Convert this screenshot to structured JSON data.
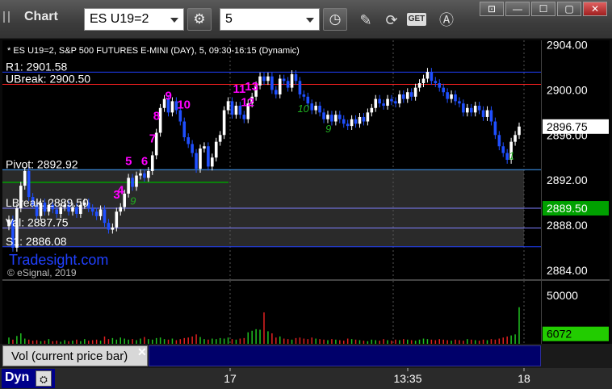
{
  "toolbar": {
    "title": "Chart",
    "symbol": "ES U19=2",
    "interval": "5",
    "get_label": "GET"
  },
  "colors": {
    "up_candle": "#ffffff",
    "down_candle": "#1f4fff",
    "r1_line": "#2040ff",
    "ubreak_line": "#ff2020",
    "pivot_line": "#40a0ff",
    "lbreak_line": "#7f7fff",
    "s1_line": "#2040ff",
    "green_line": "#00a000",
    "magenta_label": "#ff00ff",
    "green_label": "#20b020",
    "last_price_bg": "#ffffff",
    "lbreak_price_bg": "#00a000",
    "vol_label_bg": "#22cc00"
  },
  "chart_data": {
    "type": "candlestick",
    "title": "* ES U19=2, S&P 500 FUTURES E-MINI (DAY), 5, 09:30-16:15 (Dynamic)",
    "watermark": "Tradesight.com",
    "copyright": "© eSignal, 2019",
    "y_ticks": [
      "2904.00",
      "2900.00",
      "2896.00",
      "2892.00",
      "2888.00",
      "2884.00"
    ],
    "y_range": [
      2883.2,
      2904.4
    ],
    "x_ticks": [
      "17",
      "13:35",
      "18"
    ],
    "levels": [
      {
        "name": "R1",
        "label": "R1: 2901.58",
        "value": 2901.58
      },
      {
        "name": "UBreak",
        "label": "UBreak: 2900.50",
        "value": 2900.5
      },
      {
        "name": "Pivot",
        "label": "Pivot: 2892.92",
        "value": 2892.92
      },
      {
        "name": "LBreak",
        "label": "LBreak: 2889.50",
        "value": 2889.5
      },
      {
        "name": "Val",
        "label": "Val: 2887.75",
        "value": 2887.75
      },
      {
        "name": "S1",
        "label": "S1: 2886.08",
        "value": 2886.08
      }
    ],
    "green_level": 2891.8,
    "last_price": "2896.75",
    "lbreak_tag": "2889.50",
    "closes": [
      2888.5,
      2886.0,
      2889.5,
      2891.5,
      2892.8,
      2890.5,
      2889.8,
      2888.8,
      2890.0,
      2889.2,
      2889.8,
      2889.4,
      2889.0,
      2889.6,
      2889.8,
      2889.2,
      2889.6,
      2889.0,
      2889.8,
      2890.0,
      2889.5,
      2889.2,
      2888.8,
      2889.4,
      2888.2,
      2887.6,
      2887.8,
      2889.2,
      2889.6,
      2890.8,
      2892.2,
      2891.4,
      2892.4,
      2892.6,
      2892.2,
      2892.8,
      2894.2,
      2896.2,
      2898.4,
      2899.2,
      2898.0,
      2899.0,
      2898.2,
      2897.2,
      2895.8,
      2895.2,
      2894.4,
      2893.0,
      2894.8,
      2895.0,
      2893.2,
      2894.0,
      2895.4,
      2896.0,
      2898.2,
      2899.0,
      2897.8,
      2898.6,
      2897.8,
      2897.4,
      2898.8,
      2899.4,
      2900.4,
      2901.2,
      2900.8,
      2901.2,
      2900.0,
      2899.6,
      2901.0,
      2900.8,
      2900.2,
      2901.4,
      2900.8,
      2899.6,
      2899.4,
      2898.8,
      2898.2,
      2898.6,
      2898.0,
      2897.4,
      2897.8,
      2897.2,
      2897.8,
      2897.4,
      2897.0,
      2896.8,
      2897.4,
      2897.0,
      2897.6,
      2897.2,
      2898.0,
      2898.4,
      2899.2,
      2898.8,
      2898.6,
      2899.2,
      2899.0,
      2898.8,
      2899.6,
      2899.2,
      2899.8,
      2899.4,
      2900.2,
      2900.6,
      2901.0,
      2901.6,
      2900.8,
      2900.6,
      2900.2,
      2899.8,
      2899.2,
      2899.6,
      2899.0,
      2898.8,
      2898.0,
      2898.4,
      2898.0,
      2898.6,
      2898.2,
      2897.6,
      2898.2,
      2897.2,
      2896.0,
      2895.0,
      2894.4,
      2893.8,
      2895.4,
      2896.0,
      2896.75
    ],
    "volumes": [
      12,
      8,
      15,
      20,
      10,
      8,
      6,
      7,
      5,
      6,
      9,
      5,
      6,
      4,
      7,
      5,
      6,
      8,
      5,
      9,
      6,
      7,
      8,
      6,
      14,
      9,
      11,
      8,
      12,
      10,
      8,
      9,
      7,
      10,
      13,
      9,
      8,
      11,
      12,
      9,
      8,
      10,
      7,
      9,
      11,
      12,
      14,
      18,
      13,
      9,
      8,
      10,
      9,
      11,
      10,
      12,
      9,
      8,
      10,
      11,
      22,
      25,
      28,
      27,
      60,
      24,
      20,
      12,
      14,
      10,
      9,
      8,
      11,
      12,
      10,
      9,
      12,
      10,
      9,
      8,
      7,
      9,
      8,
      7,
      6,
      10,
      9,
      8,
      7,
      6,
      5,
      8,
      7,
      6,
      9,
      7,
      6,
      8,
      7,
      9,
      8,
      7,
      6,
      8,
      10,
      9,
      8,
      7,
      9,
      8,
      7,
      6,
      8,
      7,
      6,
      9,
      8,
      7,
      6,
      8,
      7,
      9,
      8,
      10,
      12,
      14,
      16,
      18,
      70
    ],
    "vol_ticks": [
      "50000",
      "6072"
    ],
    "vol_range": [
      0,
      60000
    ],
    "current_volume": 6072,
    "study_label": "Vol (current price bar)",
    "count_labels_magenta": [
      {
        "text": "3",
        "bar": 27
      },
      {
        "text": "4",
        "bar": 28
      },
      {
        "text": "5",
        "bar": 30
      },
      {
        "text": "6",
        "bar": 34
      },
      {
        "text": "7",
        "bar": 36
      },
      {
        "text": "8",
        "bar": 37
      },
      {
        "text": "9",
        "bar": 40
      },
      {
        "text": "10",
        "bar": 43
      },
      {
        "text": "11",
        "bar": 57
      },
      {
        "text": "12",
        "bar": 59
      },
      {
        "text": "13",
        "bar": 60
      }
    ],
    "count_labels_green": [
      {
        "text": "9",
        "bar": 31
      },
      {
        "text": "10",
        "bar": 73
      },
      {
        "text": "9",
        "bar": 80
      },
      {
        "text": "1",
        "bar": 126
      }
    ]
  },
  "bottom": {
    "dyn_label": "Dyn"
  }
}
